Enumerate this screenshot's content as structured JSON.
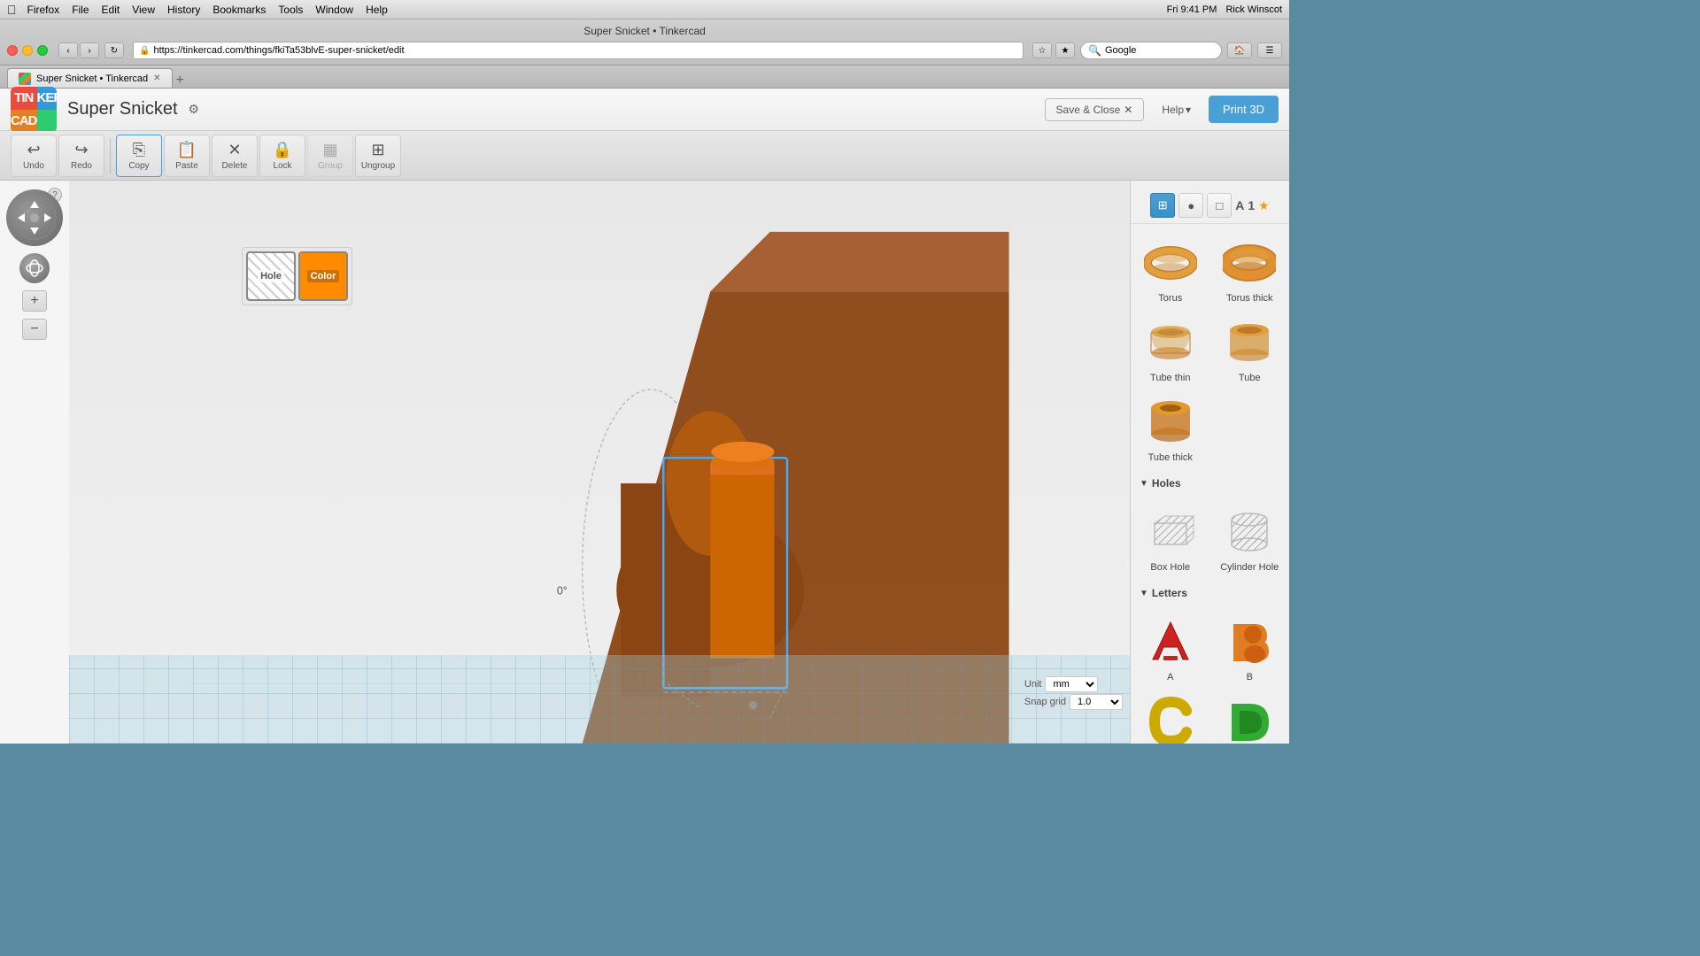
{
  "window": {
    "title": "Super Snicket • Tinkercad",
    "time": "Fri 9:41 PM",
    "user": "Rick Winscot"
  },
  "menubar": {
    "apple": "🍎",
    "items": [
      "Firefox",
      "File",
      "Edit",
      "View",
      "History",
      "Bookmarks",
      "Tools",
      "Window",
      "Help"
    ]
  },
  "browser": {
    "url": "https://tinkercad.com/things/fkiTa53blvE-super-snicket/edit",
    "search_placeholder": "Google"
  },
  "tab": {
    "title": "Super Snicket • Tinkercad"
  },
  "header": {
    "title": "Super Snicket",
    "save_close": "Save & Close",
    "help": "Help",
    "print3d": "Print 3D"
  },
  "toolbar": {
    "undo": "Undo",
    "redo": "Redo",
    "copy": "Copy",
    "paste": "Paste",
    "delete": "Delete",
    "lock": "Lock",
    "group": "Group",
    "ungroup": "Ungroup"
  },
  "color_panel": {
    "hole": "Hole",
    "color": "Color"
  },
  "viewport": {
    "coord_label": "0°"
  },
  "units": {
    "unit_label": "Unit",
    "unit_value": "mm",
    "snap_label": "Snap grid",
    "snap_value": "1.0"
  },
  "sidebar": {
    "view_buttons": [
      "grid-icon",
      "sphere-icon",
      "box-outline-icon",
      "letter-A-icon",
      "number-1",
      "star-icon"
    ],
    "shapes": [
      {
        "label": "Torus",
        "type": "torus"
      },
      {
        "label": "Torus thick",
        "type": "torus-thick"
      },
      {
        "label": "Tube thin",
        "type": "tube-thin"
      },
      {
        "label": "Tube",
        "type": "tube"
      },
      {
        "label": "Tube thick",
        "type": "tube-thick"
      }
    ],
    "holes_section": "Holes",
    "holes": [
      {
        "label": "Box Hole",
        "type": "box-hole"
      },
      {
        "label": "Cylinder Hole",
        "type": "cylinder-hole"
      }
    ],
    "letters_section": "Letters",
    "letters": [
      {
        "label": "A",
        "color": "#cc2222"
      },
      {
        "label": "B",
        "color": "#e07c22"
      },
      {
        "label": "C",
        "color": "#ccaa00"
      },
      {
        "label": "D",
        "color": "#33aa33"
      }
    ]
  }
}
